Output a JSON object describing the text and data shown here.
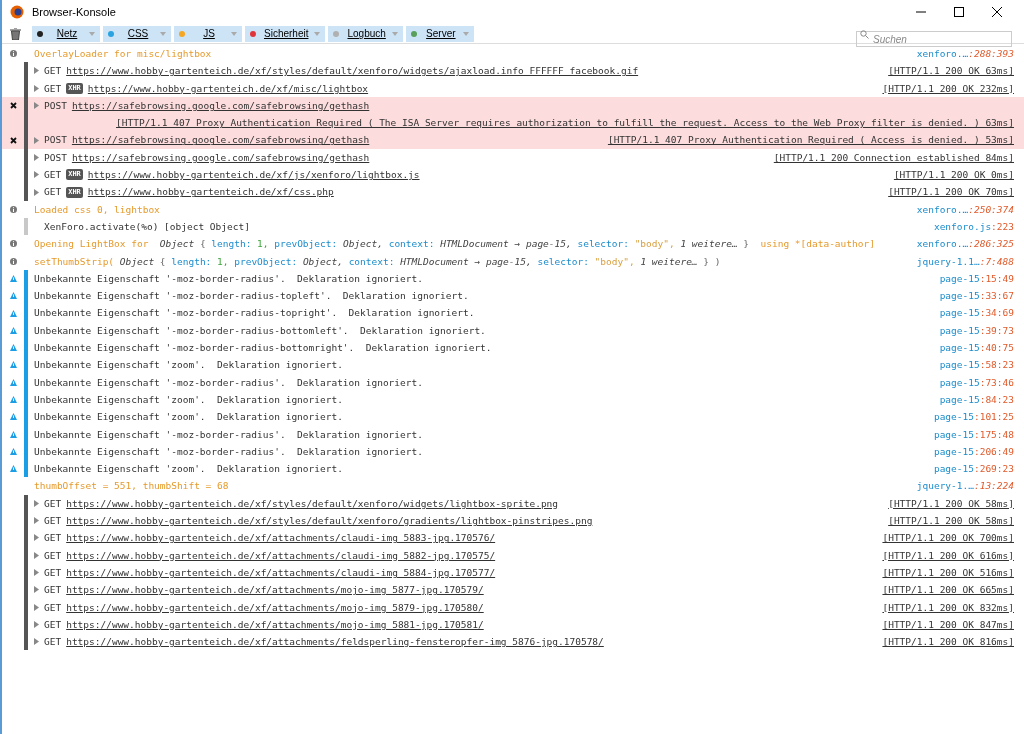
{
  "window": {
    "title": "Browser-Konsole"
  },
  "filters": [
    {
      "label": "Netz",
      "color": "#222222",
      "selected": true
    },
    {
      "label": "CSS",
      "color": "#2aa3e0",
      "selected": true
    },
    {
      "label": "JS",
      "color": "#f5a623",
      "selected": true
    },
    {
      "label": "Sicherheit",
      "color": "#e0343a",
      "selected": true
    },
    {
      "label": "Logbuch",
      "color": "#b0b0b0",
      "selected": true
    },
    {
      "label": "Server",
      "color": "#5aa05a",
      "selected": true
    }
  ],
  "search": {
    "placeholder": "Suchen"
  },
  "messages": [
    {
      "kind": "js",
      "segments": [
        {
          "kind": "log",
          "text": "OverlayLoader for misc/lightbox"
        }
      ],
      "file": "xenforo.…",
      "pos": ":288:393"
    },
    {
      "kind": "net",
      "method": "GET",
      "error": false,
      "url": "https://www.hobby-gartenteich.de/xf/styles/default/xenforo/widgets/ajaxload.info_FFFFFF_facebook.gif",
      "status": "[HTTP/1.1 200 OK 63ms]"
    },
    {
      "kind": "net",
      "method": "GET",
      "badge": "XHR",
      "error": false,
      "url": "https://www.hobby-gartenteich.de/xf/misc/lightbox",
      "status": "[HTTP/1.1 200 OK 232ms]"
    },
    {
      "kind": "net",
      "method": "POST",
      "error": true,
      "url": "https://safebrowsing.google.com/safebrowsing/gethash",
      "status": "[HTTP/1.1 407 Proxy Authentication Required ( The ISA Server requires authorization to fulfill the request. Access to the Web Proxy filter is denied.  ) 63ms]"
    },
    {
      "kind": "net",
      "method": "POST",
      "error": true,
      "url": "https://safebrowsing.google.com/safebrowsing/gethash",
      "status": "[HTTP/1.1 407 Proxy Authentication Required ( Access is denied.  ) 53ms]"
    },
    {
      "kind": "net",
      "method": "POST",
      "error": false,
      "url": "https://safebrowsing.google.com/safebrowsing/gethash",
      "status": "[HTTP/1.1 200 Connection established 84ms]"
    },
    {
      "kind": "net",
      "method": "GET",
      "badge": "XHR",
      "error": false,
      "url": "https://www.hobby-gartenteich.de/xf/js/xenforo/lightbox.js",
      "status": "[HTTP/1.1 200 OK 0ms]"
    },
    {
      "kind": "net",
      "method": "GET",
      "badge": "XHR",
      "error": false,
      "url": "https://www.hobby-gartenteich.de/xf/css.php",
      "status": "[HTTP/1.1 200 OK 70ms]"
    },
    {
      "kind": "js",
      "segments": [
        {
          "kind": "log",
          "text": "Loaded css 0, lightbox"
        }
      ],
      "file": "xenforo.…",
      "pos": ":250:374"
    },
    {
      "kind": "plain",
      "segments": [
        {
          "kind": "plain",
          "text": "XenForo.activate(%o) [object Object]"
        }
      ],
      "file": "xenforo.js",
      "pos": ":223"
    },
    {
      "kind": "js",
      "segments": [
        {
          "kind": "log",
          "text": "Opening LightBox for "
        },
        {
          "kind": "obj",
          "text": "Object"
        },
        {
          "kind": "punct",
          "text": "{"
        },
        {
          "kind": "key",
          "text": "length:"
        },
        {
          "kind": "num",
          "text": "1,"
        },
        {
          "kind": "key",
          "text": "prevObject:"
        },
        {
          "kind": "obj",
          "text": "Object,"
        },
        {
          "kind": "key",
          "text": "context:"
        },
        {
          "kind": "obj",
          "text": "HTMLDocument → page-15,"
        },
        {
          "kind": "key",
          "text": "selector:"
        },
        {
          "kind": "str",
          "text": "\"body\","
        },
        {
          "kind": "obj",
          "text": "1 weitere…"
        },
        {
          "kind": "punct",
          "text": "}"
        },
        {
          "kind": "log",
          "text": " using *[data-author]"
        }
      ],
      "file": "xenforo.…",
      "pos": ":286:325"
    },
    {
      "kind": "js",
      "segments": [
        {
          "kind": "log",
          "text": "setThumbStrip("
        },
        {
          "kind": "obj",
          "text": "Object"
        },
        {
          "kind": "punct",
          "text": "{"
        },
        {
          "kind": "key",
          "text": "length:"
        },
        {
          "kind": "num",
          "text": "1,"
        },
        {
          "kind": "key",
          "text": "prevObject:"
        },
        {
          "kind": "obj",
          "text": "Object,"
        },
        {
          "kind": "key",
          "text": "context:"
        },
        {
          "kind": "obj",
          "text": "HTMLDocument → page-15,"
        },
        {
          "kind": "key",
          "text": "selector:"
        },
        {
          "kind": "str",
          "text": "\"body\","
        },
        {
          "kind": "obj",
          "text": "1 weitere…"
        },
        {
          "kind": "punct",
          "text": "} )"
        }
      ],
      "file": "jquery-1.1…",
      "pos": ":7:488"
    },
    {
      "kind": "css",
      "segments": [
        {
          "kind": "plain",
          "text": "Unbekannte Eigenschaft '-moz-border-radius'.  Deklaration ignoriert."
        }
      ],
      "file": "page-15",
      "pos": ":15:49"
    },
    {
      "kind": "css",
      "segments": [
        {
          "kind": "plain",
          "text": "Unbekannte Eigenschaft '-moz-border-radius-topleft'.  Deklaration ignoriert."
        }
      ],
      "file": "page-15",
      "pos": ":33:67"
    },
    {
      "kind": "css",
      "segments": [
        {
          "kind": "plain",
          "text": "Unbekannte Eigenschaft '-moz-border-radius-topright'.  Deklaration ignoriert."
        }
      ],
      "file": "page-15",
      "pos": ":34:69"
    },
    {
      "kind": "css",
      "segments": [
        {
          "kind": "plain",
          "text": "Unbekannte Eigenschaft '-moz-border-radius-bottomleft'.  Deklaration ignoriert."
        }
      ],
      "file": "page-15",
      "pos": ":39:73"
    },
    {
      "kind": "css",
      "segments": [
        {
          "kind": "plain",
          "text": "Unbekannte Eigenschaft '-moz-border-radius-bottomright'.  Deklaration ignoriert."
        }
      ],
      "file": "page-15",
      "pos": ":40:75"
    },
    {
      "kind": "css",
      "segments": [
        {
          "kind": "plain",
          "text": "Unbekannte Eigenschaft 'zoom'.  Deklaration ignoriert."
        }
      ],
      "file": "page-15",
      "pos": ":58:23"
    },
    {
      "kind": "css",
      "segments": [
        {
          "kind": "plain",
          "text": "Unbekannte Eigenschaft '-moz-border-radius'.  Deklaration ignoriert."
        }
      ],
      "file": "page-15",
      "pos": ":73:46"
    },
    {
      "kind": "css",
      "segments": [
        {
          "kind": "plain",
          "text": "Unbekannte Eigenschaft 'zoom'.  Deklaration ignoriert."
        }
      ],
      "file": "page-15",
      "pos": ":84:23"
    },
    {
      "kind": "css",
      "segments": [
        {
          "kind": "plain",
          "text": "Unbekannte Eigenschaft 'zoom'.  Deklaration ignoriert."
        }
      ],
      "file": "page-15",
      "pos": ":101:25"
    },
    {
      "kind": "css",
      "segments": [
        {
          "kind": "plain",
          "text": "Unbekannte Eigenschaft '-moz-border-radius'.  Deklaration ignoriert."
        }
      ],
      "file": "page-15",
      "pos": ":175:48"
    },
    {
      "kind": "css",
      "segments": [
        {
          "kind": "plain",
          "text": "Unbekannte Eigenschaft '-moz-border-radius'.  Deklaration ignoriert."
        }
      ],
      "file": "page-15",
      "pos": ":206:49"
    },
    {
      "kind": "css",
      "segments": [
        {
          "kind": "plain",
          "text": "Unbekannte Eigenschaft 'zoom'.  Deklaration ignoriert."
        }
      ],
      "file": "page-15",
      "pos": ":269:23"
    },
    {
      "kind": "jsplain",
      "segments": [
        {
          "kind": "log",
          "text": "thumbOffset = 551, thumbShift = 68"
        }
      ],
      "file": "jquery-1.…",
      "pos": ":13:224"
    },
    {
      "kind": "net",
      "method": "GET",
      "error": false,
      "url": "https://www.hobby-gartenteich.de/xf/styles/default/xenforo/widgets/lightbox-sprite.png",
      "status": "[HTTP/1.1 200 OK 58ms]"
    },
    {
      "kind": "net",
      "method": "GET",
      "error": false,
      "url": "https://www.hobby-gartenteich.de/xf/styles/default/xenforo/gradients/lightbox-pinstripes.png",
      "status": "[HTTP/1.1 200 OK 58ms]"
    },
    {
      "kind": "net",
      "method": "GET",
      "error": false,
      "url": "https://www.hobby-gartenteich.de/xf/attachments/claudi-img_5883-jpg.170576/",
      "status": "[HTTP/1.1 200 OK 700ms]"
    },
    {
      "kind": "net",
      "method": "GET",
      "error": false,
      "url": "https://www.hobby-gartenteich.de/xf/attachments/claudi-img_5882-jpg.170575/",
      "status": "[HTTP/1.1 200 OK 616ms]"
    },
    {
      "kind": "net",
      "method": "GET",
      "error": false,
      "url": "https://www.hobby-gartenteich.de/xf/attachments/claudi-img_5884-jpg.170577/",
      "status": "[HTTP/1.1 200 OK 516ms]"
    },
    {
      "kind": "net",
      "method": "GET",
      "error": false,
      "url": "https://www.hobby-gartenteich.de/xf/attachments/mojo-img_5877-jpg.170579/",
      "status": "[HTTP/1.1 200 OK 665ms]"
    },
    {
      "kind": "net",
      "method": "GET",
      "error": false,
      "url": "https://www.hobby-gartenteich.de/xf/attachments/mojo-img_5879-jpg.170580/",
      "status": "[HTTP/1.1 200 OK 832ms]"
    },
    {
      "kind": "net",
      "method": "GET",
      "error": false,
      "url": "https://www.hobby-gartenteich.de/xf/attachments/mojo-img_5881-jpg.170581/",
      "status": "[HTTP/1.1 200 OK 847ms]"
    },
    {
      "kind": "net",
      "method": "GET",
      "error": false,
      "url": "https://www.hobby-gartenteich.de/xf/attachments/feldsperling-fensteropfer-img_5876-jpg.170578/",
      "status": "[HTTP/1.1 200 OK 816ms]"
    }
  ]
}
